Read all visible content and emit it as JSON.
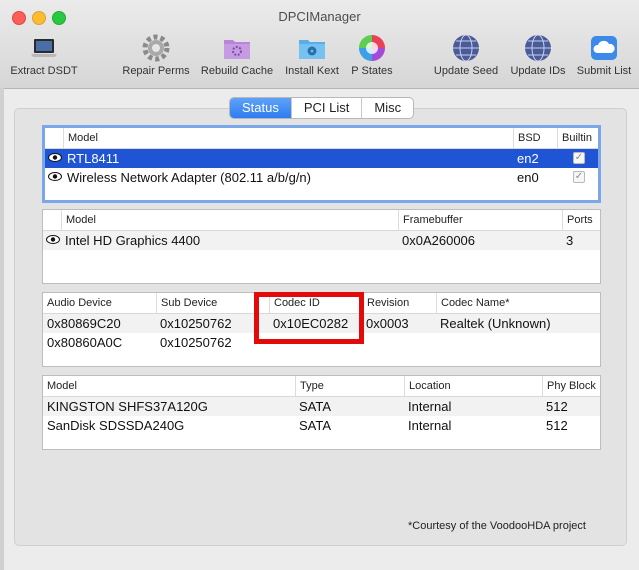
{
  "window": {
    "title": "DPCIManager"
  },
  "toolbar": [
    {
      "label": "Extract DSDT",
      "icon": "laptop-icon"
    },
    {
      "label": "Repair Perms",
      "icon": "gear-icon"
    },
    {
      "label": "Rebuild Cache",
      "icon": "folder-gear-icon"
    },
    {
      "label": "Install Kext",
      "icon": "folder-radiation-icon"
    },
    {
      "label": "P States",
      "icon": "color-wheel-icon"
    },
    {
      "label": "Update Seed",
      "icon": "globe-icon"
    },
    {
      "label": "Update IDs",
      "icon": "globe-icon"
    },
    {
      "label": "Submit List",
      "icon": "cloud-icon"
    }
  ],
  "tabs": [
    {
      "label": "Status",
      "active": true
    },
    {
      "label": "PCI List",
      "active": false
    },
    {
      "label": "Misc",
      "active": false
    }
  ],
  "network": {
    "headers": [
      "Model",
      "BSD",
      "Builtin"
    ],
    "rows": [
      {
        "model": "RTL8411",
        "bsd": "en2",
        "builtin": true
      },
      {
        "model": "Wireless Network Adapter (802.11 a/b/g/n)",
        "bsd": "en0",
        "builtin": true
      }
    ]
  },
  "graphics": {
    "headers": [
      "Model",
      "Framebuffer",
      "Ports"
    ],
    "rows": [
      {
        "model": "Intel HD Graphics 4400",
        "framebuffer": "0x0A260006",
        "ports": "3"
      }
    ]
  },
  "audio": {
    "headers": [
      "Audio Device",
      "Sub Device",
      "Codec ID",
      "Revision",
      "Codec Name*"
    ],
    "rows": [
      {
        "device": "0x80869C20",
        "sub": "0x10250762",
        "codec": "0x10EC0282",
        "revision": "0x0003",
        "name": "Realtek (Unknown)"
      },
      {
        "device": "0x80860A0C",
        "sub": "0x10250762",
        "codec": "",
        "revision": "",
        "name": ""
      }
    ]
  },
  "storage": {
    "headers": [
      "Model",
      "Type",
      "Location",
      "Phy Block"
    ],
    "rows": [
      {
        "model": "KINGSTON SHFS37A120G",
        "type": "SATA",
        "location": "Internal",
        "block": "512"
      },
      {
        "model": "SanDisk SDSSDA240G",
        "type": "SATA",
        "location": "Internal",
        "block": "512"
      }
    ]
  },
  "footnote": "*Courtesy of the VoodooHDA project",
  "colors": {
    "selection": "#1f55d4",
    "highlight_box": "#e30a0a",
    "tab_active": "#2d7cf0"
  }
}
